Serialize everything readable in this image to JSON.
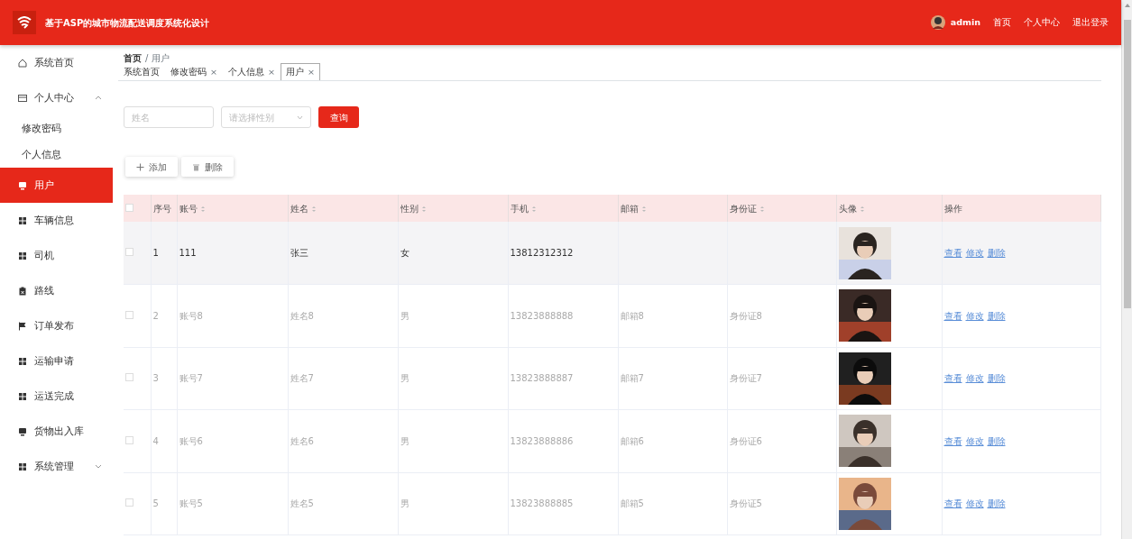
{
  "header": {
    "title": "基于ASP的城市物流配送调度系统化设计",
    "user": "admin",
    "links": [
      "首页",
      "个人中心",
      "退出登录"
    ]
  },
  "sidebar": {
    "items": [
      {
        "label": "系统首页",
        "selected": false
      },
      {
        "label": "个人中心",
        "selected": false,
        "expanded": true,
        "children": [
          {
            "label": "修改密码",
            "selected": false
          },
          {
            "label": "个人信息",
            "selected": false
          }
        ]
      },
      {
        "label": "用户",
        "selected": true
      },
      {
        "label": "车辆信息",
        "selected": false
      },
      {
        "label": "司机",
        "selected": false
      },
      {
        "label": "路线",
        "selected": false
      },
      {
        "label": "订单发布",
        "selected": false
      },
      {
        "label": "运输申请",
        "selected": false
      },
      {
        "label": "运送完成",
        "selected": false
      },
      {
        "label": "货物出入库",
        "selected": false
      },
      {
        "label": "系统管理",
        "selected": false,
        "expanded": false
      }
    ]
  },
  "breadcrumb": {
    "items": [
      "首页",
      "用户"
    ],
    "separator": "/"
  },
  "tabs": [
    {
      "label": "系统首页",
      "selected": false
    },
    {
      "label": "修改密码",
      "close": "×",
      "selected": false
    },
    {
      "label": "个人信息",
      "close": "×",
      "selected": false
    },
    {
      "label": "用户",
      "close": "×",
      "selected": true
    }
  ],
  "search": {
    "name": {
      "placeholder": "姓名"
    },
    "gender": {
      "placeholder": "请选择性别"
    },
    "button": "查询"
  },
  "actions": [
    "添加",
    "删除"
  ],
  "table": {
    "select_all_checked": false,
    "columns": [
      {
        "label": "序号",
        "sortable": false
      },
      {
        "label": "账号",
        "sortable": true
      },
      {
        "label": "姓名",
        "sortable": true
      },
      {
        "label": "性别",
        "sortable": true
      },
      {
        "label": "手机",
        "sortable": true
      },
      {
        "label": "邮箱",
        "sortable": true
      },
      {
        "label": "身份证",
        "sortable": true
      },
      {
        "label": "头像",
        "sortable": true
      },
      {
        "label": "操作",
        "sortable": false
      }
    ],
    "rows": [
      {
        "cells": [
          "1",
          "111",
          "张三",
          "女",
          "13812312312",
          "",
          ""
        ],
        "actions": [
          "查看",
          "修改",
          "删除"
        ],
        "hovered": true,
        "checked": false
      },
      {
        "cells": [
          "2",
          "账号8",
          "姓名8",
          "男",
          "13823888888",
          "邮箱8",
          "身份证8"
        ],
        "actions": [
          "查看",
          "修改",
          "删除"
        ],
        "hovered": false,
        "checked": false
      },
      {
        "cells": [
          "3",
          "账号7",
          "姓名7",
          "男",
          "13823888887",
          "邮箱7",
          "身份证7"
        ],
        "actions": [
          "查看",
          "修改",
          "删除"
        ],
        "hovered": false,
        "checked": false
      },
      {
        "cells": [
          "4",
          "账号6",
          "姓名6",
          "男",
          "13823888886",
          "邮箱6",
          "身份证6"
        ],
        "actions": [
          "查看",
          "修改",
          "删除"
        ],
        "hovered": false,
        "checked": false
      },
      {
        "cells": [
          "5",
          "账号5",
          "姓名5",
          "男",
          "13823888885",
          "邮箱5",
          "身份证5"
        ],
        "actions": [
          "查看",
          "修改",
          "删除"
        ],
        "hovered": false,
        "checked": false
      }
    ]
  }
}
